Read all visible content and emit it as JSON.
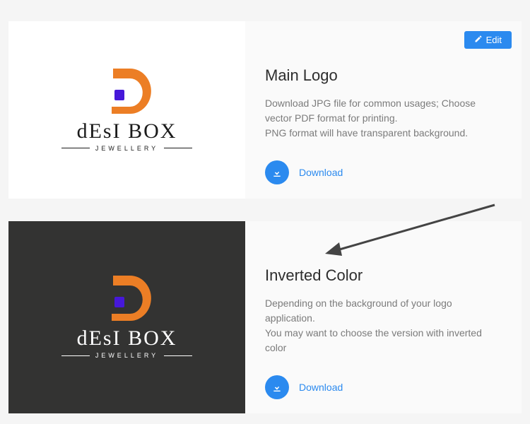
{
  "colors": {
    "accent_orange": "#ec7e25",
    "accent_purple": "#4618d9",
    "primary_blue": "#2b8aef",
    "dark_panel": "#333332"
  },
  "brand": {
    "name": "dEsI BOX",
    "tagline": "JEWELLERY"
  },
  "edit_button": {
    "label": "Edit",
    "icon": "pencil-icon"
  },
  "cards": [
    {
      "title": "Main Logo",
      "desc_line1": "Download JPG file for common usages; Choose vector PDF format for printing.",
      "desc_line2": "PNG format will have transparent background.",
      "download_label": "Download",
      "panel_bg": "light"
    },
    {
      "title": "Inverted Color",
      "desc_line1": "Depending on the background of your logo application.",
      "desc_line2": "You may want to choose the version with inverted color",
      "download_label": "Download",
      "panel_bg": "dark"
    }
  ]
}
